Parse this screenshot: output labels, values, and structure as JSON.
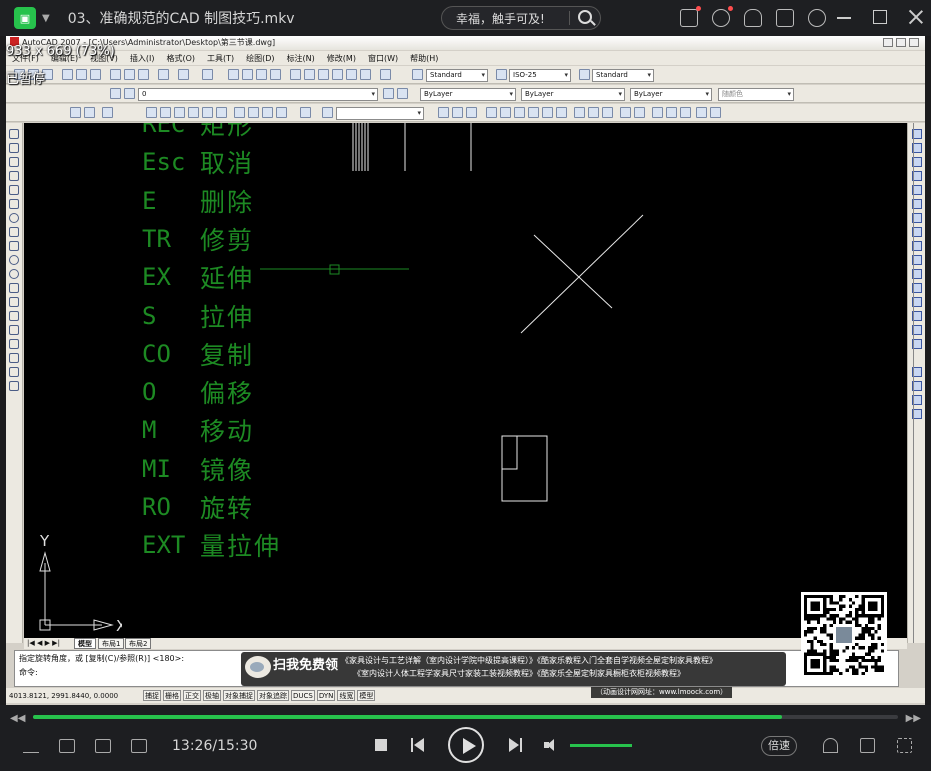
{
  "player": {
    "title": "03、准确规范的CAD 制图技巧.mkv",
    "search_text": "幸福，触手可及!",
    "time_display": "13:26/15:30",
    "progress": 0.866,
    "speed_label": "倍速",
    "accent_color": "#27c24c",
    "overlay_resolution": "933 x 669 (73%)",
    "overlay_status": "已暂停",
    "title_icons": [
      "recent-icon",
      "notify-icon",
      "hand-icon",
      "skin-icon",
      "clock-icon"
    ]
  },
  "acad": {
    "title": "AutoCAD 2007 - [C:\\Users\\Administrator\\Desktop\\第三节课.dwg]",
    "menus": [
      "文件(F)",
      "编辑(E)",
      "视图(V)",
      "插入(I)",
      "格式(O)",
      "工具(T)",
      "绘图(D)",
      "标注(N)",
      "修改(M)",
      "窗口(W)",
      "帮助(H)"
    ],
    "text_style": "Standard",
    "dim_style": "ISO-25",
    "table_style": "Standard",
    "layer": "0",
    "color": "ByLayer",
    "linetype": "ByLayer",
    "lineweight": "ByLayer",
    "plotstyle": "随颜色",
    "commands": [
      {
        "key": "REC",
        "desc": "矩形"
      },
      {
        "key": "Esc",
        "desc": "取消"
      },
      {
        "key": "E",
        "desc": "删除"
      },
      {
        "key": "TR",
        "desc": "修剪"
      },
      {
        "key": "EX",
        "desc": "延伸"
      },
      {
        "key": "S",
        "desc": "拉伸"
      },
      {
        "key": "CO",
        "desc": "复制"
      },
      {
        "key": "O",
        "desc": "偏移"
      },
      {
        "key": "M",
        "desc": "移动"
      },
      {
        "key": "MI",
        "desc": "镜像"
      },
      {
        "key": "RO",
        "desc": "旋转"
      },
      {
        "key": "EXT",
        "desc": "量拉伸"
      }
    ],
    "ucs_x": "X",
    "ucs_y": "Y",
    "tabs": [
      "模型",
      "布局1",
      "布局2"
    ],
    "cmd_line1": "指定旋转角度，或 [复制(C)/参照(R)] <180>:",
    "cmd_line2": "命令:",
    "coords": "4013.8121, 2991.8440, 0.0000",
    "status_buttons": [
      "捕捉",
      "栅格",
      "正交",
      "极轴",
      "对象捕捉",
      "对象追踪",
      "DUCS",
      "DYN",
      "线宽",
      "模型"
    ]
  },
  "promo": {
    "headline": "扫我免费领",
    "line1": "《家具设计与工艺详解（室内设计学院中级提高课程）》《酷家乐教程入门全套自学视频全屋定制家具教程》",
    "line2": "《室内设计人体工程学家具尺寸家装工装视频教程》《酷家乐全屋定制家具橱柜衣柜视频教程》",
    "website": "（动画设计网网址：www.lmoock.com）"
  }
}
